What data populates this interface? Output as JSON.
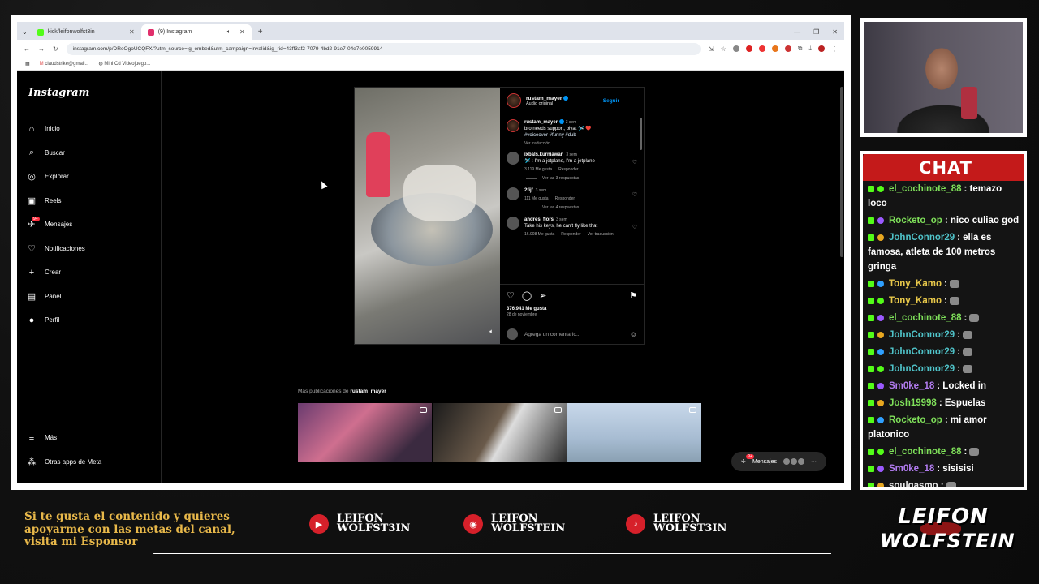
{
  "browser": {
    "tabs": [
      {
        "label": "kick/leifonwolfst3in",
        "active": false,
        "favicon_color": "#53fc18"
      },
      {
        "label": "(9) Instagram",
        "active": true,
        "favicon_color": "#e1306c"
      }
    ],
    "new_tab": "+",
    "url": "instagram.com/p/DReOgoUCQFX/?utm_source=ig_embed&utm_campaign=invalid&ig_rid=43ff3af2-7079-4bd2-91e7-04e7e0059914",
    "bookmarks": [
      "claudstrike@gmail...",
      "Mini Cd Videojuego..."
    ]
  },
  "instagram": {
    "logo": "Instagram",
    "nav": [
      {
        "label": "Inicio",
        "icon": "home-icon",
        "glyph": "⌂"
      },
      {
        "label": "Buscar",
        "icon": "search-icon",
        "glyph": "⌕"
      },
      {
        "label": "Explorar",
        "icon": "compass-icon",
        "glyph": "◎"
      },
      {
        "label": "Reels",
        "icon": "reels-icon",
        "glyph": "▣"
      },
      {
        "label": "Mensajes",
        "icon": "messages-icon",
        "glyph": "✈",
        "badge": "9+"
      },
      {
        "label": "Notificaciones",
        "icon": "heart-icon",
        "glyph": "♡"
      },
      {
        "label": "Crear",
        "icon": "plus-icon",
        "glyph": "+"
      },
      {
        "label": "Panel",
        "icon": "dashboard-icon",
        "glyph": "▤"
      },
      {
        "label": "Perfil",
        "icon": "profile-icon",
        "glyph": "●"
      }
    ],
    "bottom_nav": [
      {
        "label": "Más",
        "icon": "menu-icon",
        "glyph": "≡"
      },
      {
        "label": "Otras apps de Meta",
        "icon": "meta-apps-icon",
        "glyph": "⁂"
      }
    ],
    "post": {
      "username": "rustam_mayer",
      "audio": "Audio original",
      "follow": "Seguir",
      "caption_user": "rustam_mayer",
      "caption_age": "3 sem",
      "caption": "bro needs support, blyat 🛩️ ❤️",
      "tags": "#voiceover #funny #dub",
      "translate": "Ver traducción",
      "comments": [
        {
          "user": "ixbals.kurniawan",
          "age": "3 sem",
          "text": "🛩️ : I'm a jetplane, I'm a jetplane",
          "likes": "3.119 Me gusta",
          "reply": "Responder",
          "replies": "Ver las 3 respuestas"
        },
        {
          "user": "2fijf",
          "age": "3 sem",
          "text": "",
          "likes": "111 Me gusta",
          "reply": "Responder",
          "replies": "Ver las 4 respuestas"
        },
        {
          "user": "andres_flors",
          "age": "3 sem",
          "text": "Take his keys, he can't fly like that",
          "likes": "16.908 Me gusta",
          "reply": "Responder",
          "translate": "Ver traducción"
        }
      ],
      "likes": "376.941 Me gusta",
      "date": "28 de noviembre",
      "comment_placeholder": "Agrega un comentario..."
    },
    "more_label": "Más publicaciones de",
    "more_user": "rustam_mayer",
    "messages_pill": "Mensajes",
    "messages_badge": "9+"
  },
  "chat": {
    "title": "CHAT",
    "messages": [
      {
        "user": "el_cochinote_88",
        "color": "#7fe05a",
        "text": ": temazo loco"
      },
      {
        "user": "Rocketo_op",
        "color": "#7fe05a",
        "text": ": nico culiao god"
      },
      {
        "user": "JohnConnor29",
        "color": "#4fc3c9",
        "text": ": ella es famosa, atleta de 100 metros gringa"
      },
      {
        "user": "Tony_Kamo",
        "color": "#e8c84a",
        "text": ":"
      },
      {
        "user": "Tony_Kamo",
        "color": "#e8c84a",
        "text": ":"
      },
      {
        "user": "el_cochinote_88",
        "color": "#7fe05a",
        "text": ":"
      },
      {
        "user": "JohnConnor29",
        "color": "#4fc3c9",
        "text": ":"
      },
      {
        "user": "JohnConnor29",
        "color": "#4fc3c9",
        "text": ":"
      },
      {
        "user": "JohnConnor29",
        "color": "#4fc3c9",
        "text": ":"
      },
      {
        "user": "Sm0ke_18",
        "color": "#b27cf0",
        "text": ": Locked in"
      },
      {
        "user": "Josh19998",
        "color": "#7fe05a",
        "text": ": Espuelas"
      },
      {
        "user": "Rocketo_op",
        "color": "#7fe05a",
        "text": ": mi amor platonico"
      },
      {
        "user": "el_cochinote_88",
        "color": "#7fe05a",
        "text": ":"
      },
      {
        "user": "Sm0ke_18",
        "color": "#b27cf0",
        "text": ": sisisisi"
      },
      {
        "user": "soulgasmo",
        "color": "#e8e8e8",
        "text": ":"
      }
    ]
  },
  "overlay": {
    "sponsor": [
      "Si te gusta el contenido y quieres",
      "apoyarme con las metas del canal,",
      "visita mi Esponsor"
    ],
    "socials": [
      {
        "icon": "youtube-icon",
        "glyph": "▶",
        "line1": "LEIFON",
        "line2": "WOLFST3IN"
      },
      {
        "icon": "instagram-icon",
        "glyph": "◉",
        "line1": "LEIFON",
        "line2": "WOLFSTEIN"
      },
      {
        "icon": "tiktok-icon",
        "glyph": "♪",
        "line1": "LEIFON",
        "line2": "WOLFST3IN"
      }
    ],
    "logo_line1": "LEIFON",
    "logo_line2": "WOLFSTEIN"
  }
}
